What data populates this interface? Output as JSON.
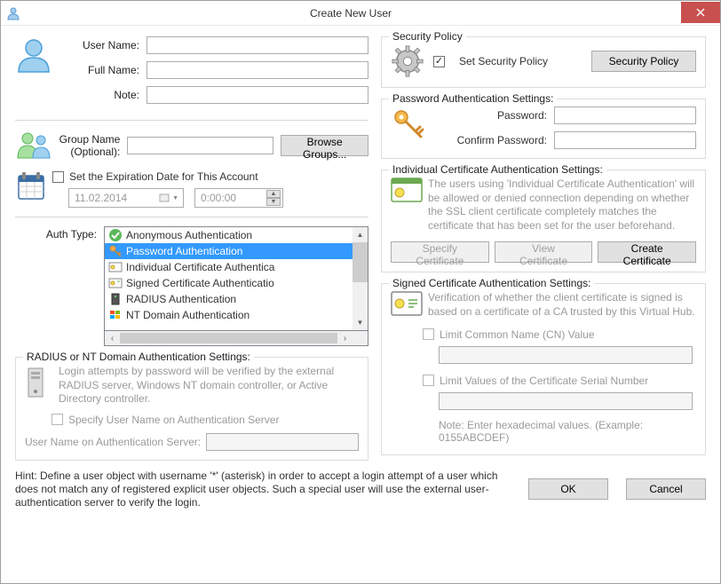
{
  "window": {
    "title": "Create New User"
  },
  "left": {
    "user_name_label": "User Name:",
    "full_name_label": "Full Name:",
    "note_label": "Note:",
    "group_name_label": "Group Name (Optional):",
    "browse_groups": "Browse Groups...",
    "set_expiration": "Set the Expiration Date for This Account",
    "expiration_date": "11.02.2014",
    "expiration_time": "0:00:00",
    "auth_type_label": "Auth Type:",
    "auth_items": [
      "Anonymous Authentication",
      "Password Authentication",
      "Individual Certificate Authentica",
      "Signed Certificate Authenticatio",
      "RADIUS Authentication",
      "NT Domain Authentication"
    ],
    "auth_extra_left": "‹",
    "auth_extra_right": "›",
    "radius_box": {
      "title": "RADIUS or NT Domain Authentication Settings:",
      "desc": "Login attempts by password will be verified by the external RADIUS server, Windows NT domain controller, or Active Directory controller.",
      "specify_user": "Specify User Name on Authentication Server",
      "user_name_label": "User Name on Authentication Server:"
    }
  },
  "right": {
    "security_box": {
      "title": "Security Policy",
      "set_policy": "Set Security Policy",
      "button": "Security Policy"
    },
    "password_box": {
      "title": "Password Authentication Settings:",
      "password": "Password:",
      "confirm": "Confirm Password:"
    },
    "indiv_cert": {
      "title": "Individual Certificate Authentication Settings:",
      "desc": "The users using 'Individual Certificate Authentication' will be allowed or denied connection depending on whether the SSL client certificate completely matches the certificate that has been set for the user beforehand.",
      "specify": "Specify Certificate",
      "view": "View Certificate",
      "create": "Create Certificate"
    },
    "signed_cert": {
      "title": "Signed Certificate Authentication Settings:",
      "desc": "Verification of whether the client certificate is signed is based on a certificate of a CA trusted by this Virtual Hub.",
      "limit_cn": "Limit Common Name (CN) Value",
      "limit_serial": "Limit Values of the Certificate Serial Number",
      "note": "Note: Enter hexadecimal values. (Example: 0155ABCDEF)"
    }
  },
  "footer": {
    "hint": "Hint: Define a user object with username '*' (asterisk) in order to accept a login attempt of a user which does not match any of registered explicit user objects. Such a special user will use the external user-authentication server to verify the login.",
    "ok": "OK",
    "cancel": "Cancel"
  }
}
